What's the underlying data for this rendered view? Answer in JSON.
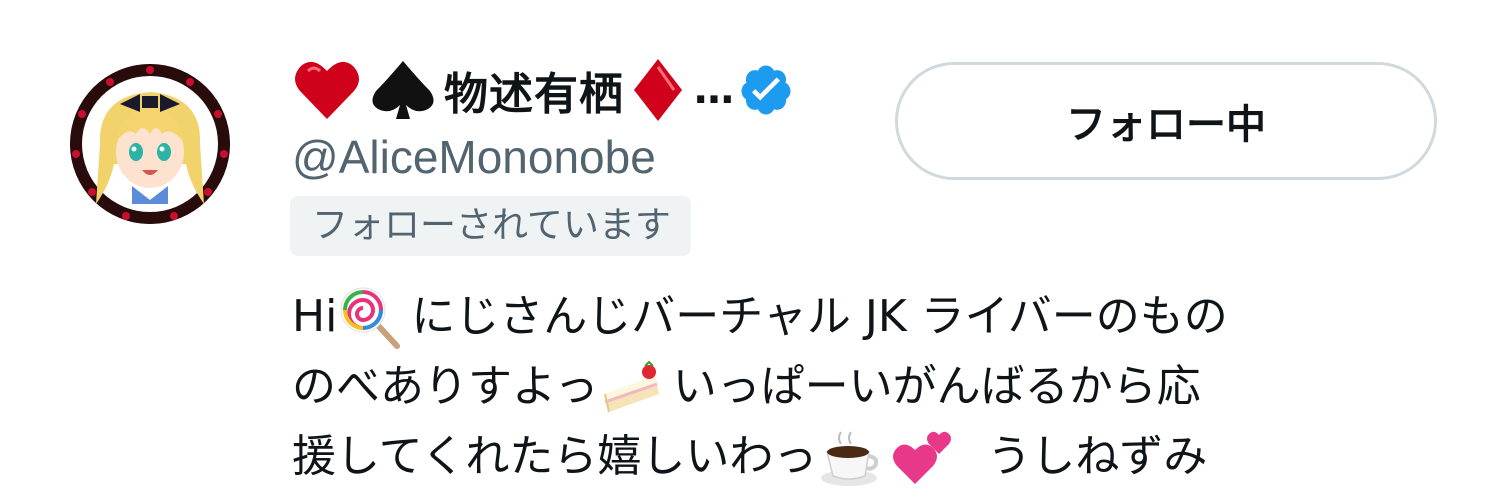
{
  "profile": {
    "display_name": "物述有栖",
    "ellipsis": "…",
    "handle": "@AliceMononobe",
    "follows_you_label": "フォローされています",
    "name_icons": [
      "red-heart-icon",
      "black-spade-icon",
      "red-diamond-icon"
    ],
    "verified_icon": "verified-badge-icon"
  },
  "actions": {
    "follow_button_label": "フォロー中"
  },
  "bio": {
    "line1_a": "Hi",
    "line1_b": "にじさんじバーチャル JK ライバーのもの",
    "line2_a": "のべありすよっ",
    "line2_b": "いっぱーいがんばるから応",
    "line3_a": "援してくれたら嬉しいわっ",
    "line3_b": "うしねずみ",
    "emojis": [
      "lollipop-icon",
      "shortcake-icon",
      "coffee-icon",
      "two-hearts-icon"
    ]
  },
  "colors": {
    "text_primary": "#0f1419",
    "text_secondary": "#536471",
    "border": "#cfd9de",
    "badge_bg": "#eff3f4",
    "verified_blue": "#1d9bf0",
    "heart_red": "#d0021b"
  }
}
